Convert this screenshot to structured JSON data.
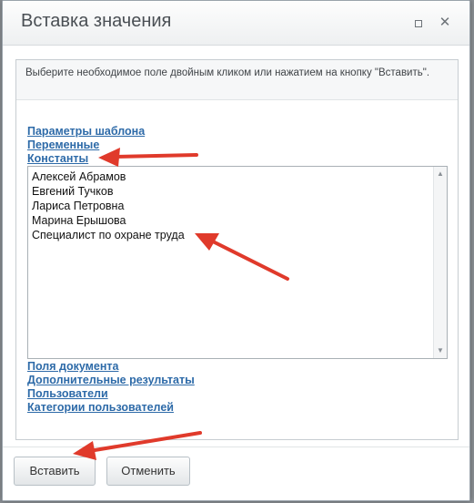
{
  "dialog": {
    "title": "Вставка значения",
    "maximize_icon": "maximize-icon",
    "close_icon": "close-icon"
  },
  "hint_text": "Выберите необходимое поле двойным кликом или нажатием на кнопку \"Вставить\".",
  "links_top": [
    "Параметры шаблона",
    "Переменные",
    "Константы"
  ],
  "list_items": [
    "Алексей Абрамов",
    "Евгений Тучков",
    "Лариса Петровна",
    "Марина Ерышова",
    "Специалист по охране труда"
  ],
  "links_bottom": [
    "Поля документа",
    "Дополнительные результаты",
    "Пользователи",
    "Категории пользователей"
  ],
  "buttons": {
    "insert": "Вставить",
    "cancel": "Отменить"
  },
  "colors": {
    "link": "#2d6aa8",
    "arrow": "#e03a2b"
  }
}
